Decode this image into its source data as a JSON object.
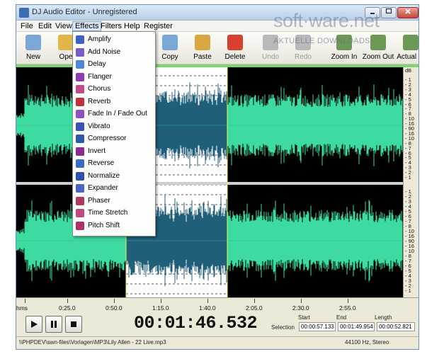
{
  "window": {
    "title": "DJ Audio Editor - Unregistered"
  },
  "watermark": {
    "main": "soft·ware.net",
    "sub": "AKTUELLE DOWNLOADS"
  },
  "menu": {
    "items": [
      {
        "label": "File"
      },
      {
        "label": "Edit"
      },
      {
        "label": "View"
      },
      {
        "label": "Effects"
      },
      {
        "label": "Filters"
      },
      {
        "label": "Help"
      },
      {
        "label": "Register"
      }
    ]
  },
  "toolbar": {
    "buttons": [
      {
        "label": "New",
        "icon": "new-file-icon",
        "color": "#7aa7d8",
        "enabled": true
      },
      {
        "label": "Ope",
        "icon": "open-folder-icon",
        "color": "#e2b44a",
        "enabled": true
      },
      {
        "label": "Copy",
        "icon": "copy-icon",
        "color": "#7aa7d8",
        "enabled": true
      },
      {
        "label": "Paste",
        "icon": "paste-icon",
        "color": "#d9a640",
        "enabled": true
      },
      {
        "label": "Delete",
        "icon": "delete-icon",
        "color": "#d9412f",
        "enabled": true
      },
      {
        "label": "Undo",
        "icon": "undo-icon",
        "color": "#b9b9b9",
        "enabled": false
      },
      {
        "label": "Redo",
        "icon": "redo-icon",
        "color": "#b9b9b9",
        "enabled": false
      },
      {
        "label": "Zoom In",
        "icon": "zoom-in-icon",
        "color": "#6c9a56",
        "enabled": true
      },
      {
        "label": "Zoom Out",
        "icon": "zoom-out-icon",
        "color": "#6c9a56",
        "enabled": true
      },
      {
        "label": "Actual Si",
        "icon": "actual-size-icon",
        "color": "#6c9a56",
        "enabled": true
      }
    ]
  },
  "effects_menu": {
    "items": [
      {
        "label": "Amplify",
        "icon": "amplify-icon",
        "color": "#3c62c8"
      },
      {
        "label": "Add Noise",
        "icon": "add-noise-icon",
        "color": "#7a5cc8"
      },
      {
        "label": "Delay",
        "icon": "delay-icon",
        "color": "#4a88d8"
      },
      {
        "label": "Flanger",
        "icon": "flanger-icon",
        "color": "#8a3fb8"
      },
      {
        "label": "Chorus",
        "icon": "chorus-icon",
        "color": "#c04a8c"
      },
      {
        "label": "Reverb",
        "icon": "reverb-icon",
        "color": "#c0303c"
      },
      {
        "label": "Fade In / Fade Out",
        "icon": "fade-icon",
        "color": "#9050c0"
      },
      {
        "label": "Vibrato",
        "icon": "vibrato-icon",
        "color": "#3a52b8"
      },
      {
        "label": "Compressor",
        "icon": "compressor-icon",
        "color": "#2a5aa8"
      },
      {
        "label": "Invert",
        "icon": "invert-icon",
        "color": "#8a2a8a"
      },
      {
        "label": "Reverse",
        "icon": "reverse-icon",
        "color": "#3a6ac8"
      },
      {
        "label": "Normalize",
        "icon": "normalize-icon",
        "color": "#3050b0"
      },
      {
        "label": "Expander",
        "icon": "expander-icon",
        "color": "#4a64c0"
      },
      {
        "label": "Phaser",
        "icon": "phaser-icon",
        "color": "#b03a5a"
      },
      {
        "label": "Time Stretch",
        "icon": "time-stretch-icon",
        "color": "#c04a80"
      },
      {
        "label": "Pitch Shift",
        "icon": "pitch-shift-icon",
        "color": "#b0306a"
      }
    ]
  },
  "db_ruler": {
    "label": "dB",
    "top_channel": [
      "- 1",
      "- 2",
      "- 3",
      "- 4",
      "- 5",
      "- 6",
      "- 7",
      "- 8",
      "- 10",
      "- 16",
      "- 90",
      "- 16",
      "- 10",
      "- 8",
      "- 7",
      "- 6",
      "- 5",
      "- 4",
      "- 3",
      "- 2",
      "- 1"
    ],
    "bottom_channel": [
      "- 1",
      "- 2",
      "- 3",
      "- 4",
      "- 5",
      "- 6",
      "- 7",
      "- 8",
      "- 10",
      "- 16",
      "- 90",
      "- 16",
      "- 10",
      "- 8",
      "- 7",
      "- 6",
      "- 5",
      "- 4",
      "- 3",
      "- 2",
      "- 1"
    ]
  },
  "time_ruler": {
    "labels": [
      "hms",
      "0:25.0",
      "0:50.0",
      "1:15.0",
      "1:40.0",
      "2:05.0",
      "2:30.0",
      "2:55.0"
    ]
  },
  "transport": {
    "play": "play-icon",
    "pause": "pause-icon",
    "stop": "stop-icon",
    "time": "00:01:46.532",
    "selection_label": "Selection",
    "start_label": "Start",
    "end_label": "End",
    "length_label": "Length",
    "start": "00:00:57.133",
    "end": "00:01:49.954",
    "length": "00:00:52.821"
  },
  "status": {
    "path": "\\\\PHPDEV\\swn-files\\Vorlagen\\MP3\\Lily Allen - 22 Live.mp3",
    "format": "44100 Hz, Stereo"
  },
  "colors": {
    "waveform": "#3ddba0",
    "waveform_selected": "#1f5f7a",
    "selection_bg": "#ffffff"
  }
}
